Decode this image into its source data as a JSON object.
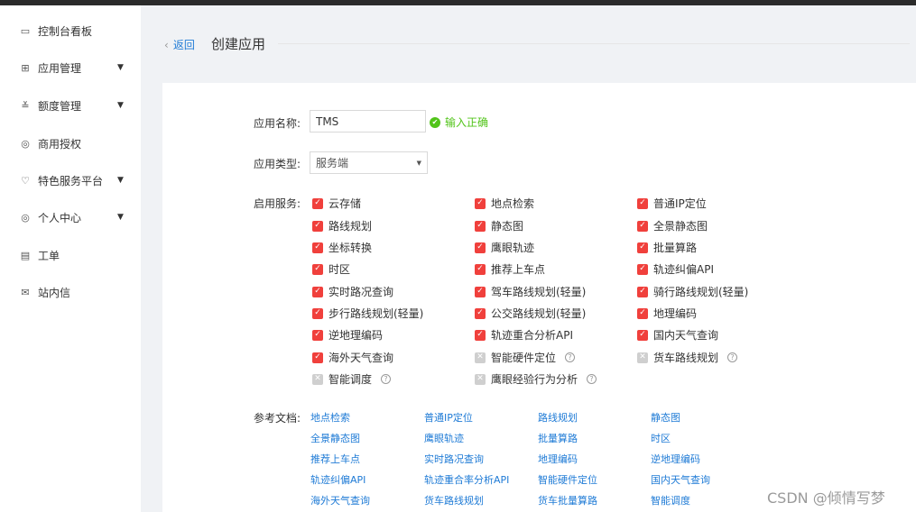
{
  "sidebar": {
    "items": [
      {
        "label": "控制台看板",
        "icon": "dashboard-icon",
        "glyph": "▭",
        "arrow": ""
      },
      {
        "label": "应用管理",
        "icon": "grid-icon",
        "glyph": "⊞",
        "arrow": "▼"
      },
      {
        "label": "额度管理",
        "icon": "sliders-icon",
        "glyph": "≚",
        "arrow": "▼"
      },
      {
        "label": "商用授权",
        "icon": "shield-check-icon",
        "glyph": "◎",
        "arrow": ""
      },
      {
        "label": "特色服务平台",
        "icon": "heart-icon",
        "glyph": "♡",
        "arrow": "▼"
      },
      {
        "label": "个人中心",
        "icon": "user-circle-icon",
        "glyph": "◎",
        "arrow": "▼"
      },
      {
        "label": "工单",
        "icon": "clipboard-icon",
        "glyph": "▤",
        "arrow": ""
      },
      {
        "label": "站内信",
        "icon": "mail-icon",
        "glyph": "✉",
        "arrow": ""
      }
    ]
  },
  "header": {
    "back_label": "返回",
    "back_chevron": "‹",
    "title": "创建应用"
  },
  "form": {
    "name_label": "应用名称:",
    "name_value": "TMS",
    "name_valid": "输入正确",
    "type_label": "应用类型:",
    "type_value": "服务端",
    "services_label": "启用服务:",
    "docs_label": "参考文档:"
  },
  "services": [
    [
      "云存储",
      "地点检索",
      "普通IP定位"
    ],
    [
      "路线规划",
      "静态图",
      "全景静态图"
    ],
    [
      "坐标转换",
      "鹰眼轨迹",
      "批量算路"
    ],
    [
      "时区",
      "推荐上车点",
      "轨迹纠偏API"
    ],
    [
      "实时路况查询",
      "驾车路线规划(轻量)",
      "骑行路线规划(轻量)"
    ],
    [
      "步行路线规划(轻量)",
      "公交路线规划(轻量)",
      "地理编码"
    ],
    [
      "逆地理编码",
      "轨迹重合分析API",
      "国内天气查询"
    ],
    [
      "海外天气查询",
      "智能硬件定位",
      "货车路线规划"
    ],
    [
      "智能调度",
      "鹰眼经验行为分析",
      ""
    ]
  ],
  "services_checked": [
    [
      true,
      true,
      true
    ],
    [
      true,
      true,
      true
    ],
    [
      true,
      true,
      true
    ],
    [
      true,
      true,
      true
    ],
    [
      true,
      true,
      true
    ],
    [
      true,
      true,
      true
    ],
    [
      true,
      true,
      true
    ],
    [
      true,
      false,
      false
    ],
    [
      false,
      false,
      false
    ]
  ],
  "docs": [
    [
      "地点检索",
      "普通IP定位",
      "路线规划",
      "静态图"
    ],
    [
      "全景静态图",
      "鹰眼轨迹",
      "批量算路",
      "时区"
    ],
    [
      "推荐上车点",
      "实时路况查询",
      "地理编码",
      "逆地理编码"
    ],
    [
      "轨迹纠偏API",
      "轨迹重合率分析API",
      "智能硬件定位",
      "国内天气查询"
    ],
    [
      "海外天气查询",
      "货车路线规划",
      "货车批量算路",
      "智能调度"
    ]
  ],
  "watermark": "CSDN @倾情写梦",
  "colors": {
    "checked": "#f0403c",
    "unchecked": "#cfcfcf",
    "link": "#1f7bd6",
    "success": "#52c41a"
  }
}
